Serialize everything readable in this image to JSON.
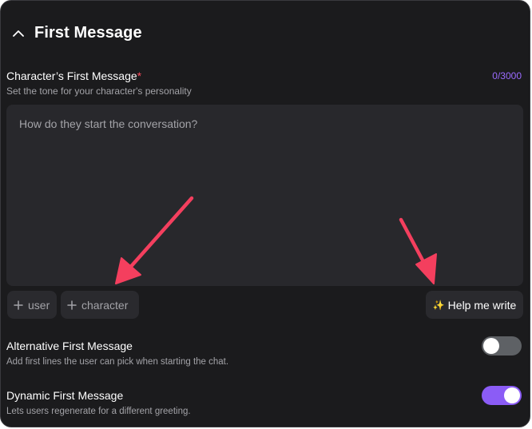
{
  "section": {
    "title": "First Message",
    "expanded": true
  },
  "first_message": {
    "label": "Character’s First Message",
    "required_marker": "*",
    "counter": "0/3000",
    "description": "Set the tone for your character's personality",
    "placeholder": "How do they start the conversation?",
    "value": ""
  },
  "insert_chips": {
    "user_label": "user",
    "character_label": "character"
  },
  "help_button": {
    "label": "Help me write",
    "icon": "sparkles-icon"
  },
  "settings": {
    "alternative": {
      "title": "Alternative First Message",
      "description": "Add first lines the user can pick when starting the chat.",
      "enabled": false
    },
    "dynamic": {
      "title": "Dynamic First Message",
      "description": "Lets users regenerate for a different greeting.",
      "enabled": true
    }
  },
  "colors": {
    "background": "#1b1b1d",
    "field_background": "#28282c",
    "accent": "#8b5cf6",
    "counter": "#9b6bff",
    "required": "#ff4d5e",
    "annotation_arrow": "#f43f5e"
  }
}
